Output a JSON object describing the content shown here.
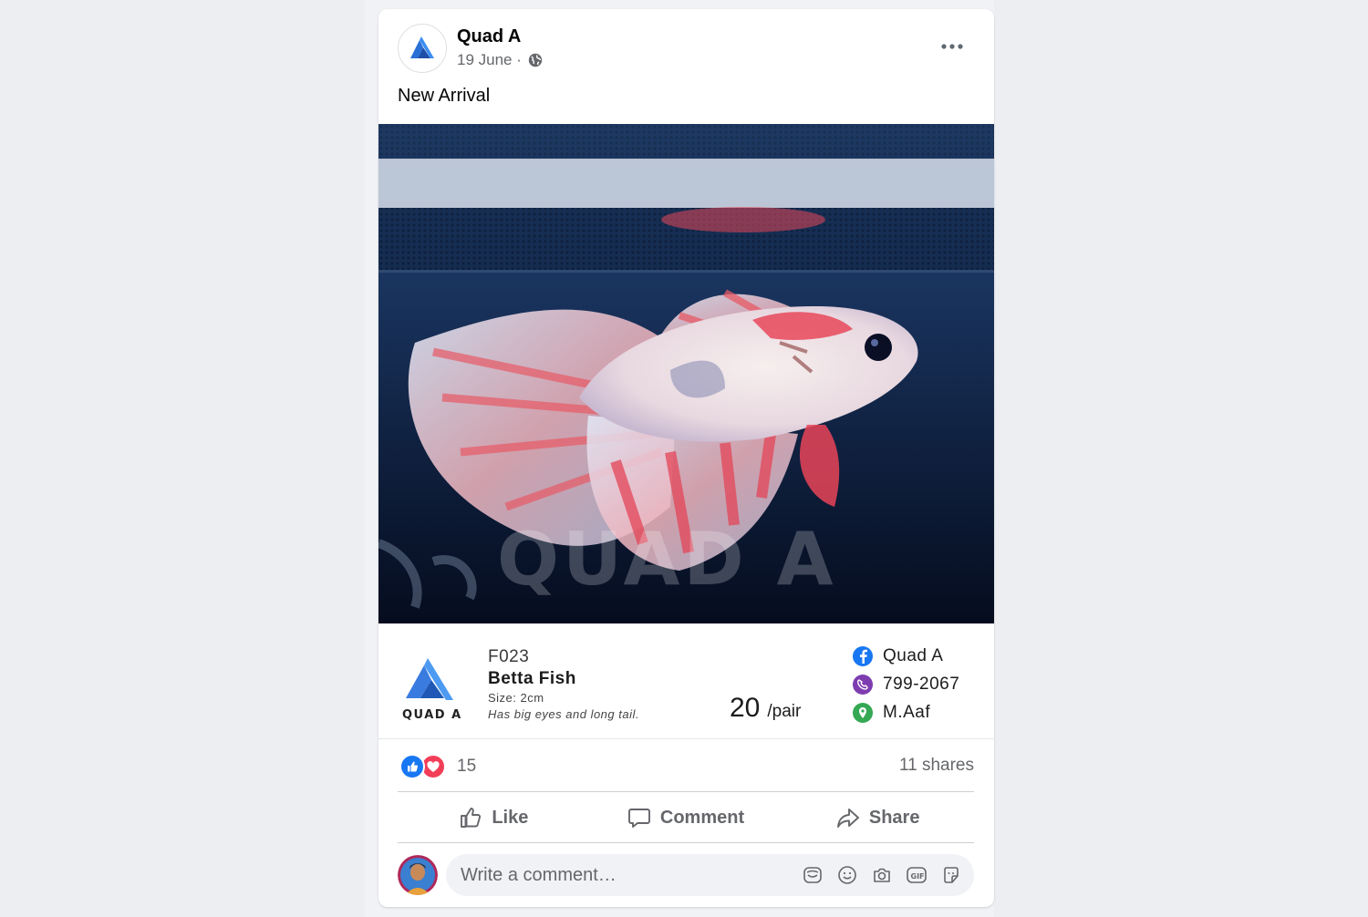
{
  "post": {
    "page_name": "Quad A",
    "date": "19 June ·",
    "privacy_icon": "globe-icon",
    "text": "New Arrival",
    "more_icon": "more-horizontal-icon"
  },
  "photo": {
    "watermark": "QUAD A"
  },
  "product": {
    "logo_text": "QUAD A",
    "code": "F023",
    "name": "Betta Fish",
    "size": "Size: 2cm",
    "description": "Has big eyes and long tail.",
    "price": "20",
    "price_unit": "/pair",
    "contacts": [
      {
        "icon": "facebook-icon",
        "text": "Quad A",
        "color": "#1877f2"
      },
      {
        "icon": "viber-icon",
        "text": "799-2067",
        "color": "#7d3daf"
      },
      {
        "icon": "location-pin-icon",
        "text": "M.Aaf",
        "color": "#34a853"
      }
    ]
  },
  "stats": {
    "reactions_count": "15",
    "shares": "11 shares"
  },
  "actions": {
    "like": "Like",
    "comment": "Comment",
    "share": "Share"
  },
  "comment": {
    "placeholder": "Write a comment…",
    "icons": [
      "avatar-sticker-icon",
      "emoji-icon",
      "camera-icon",
      "gif-icon",
      "sticker-icon"
    ]
  },
  "colors": {
    "brand_blue": "#1877f2",
    "love_red": "#f33e58",
    "secondary_text": "#65676b"
  }
}
